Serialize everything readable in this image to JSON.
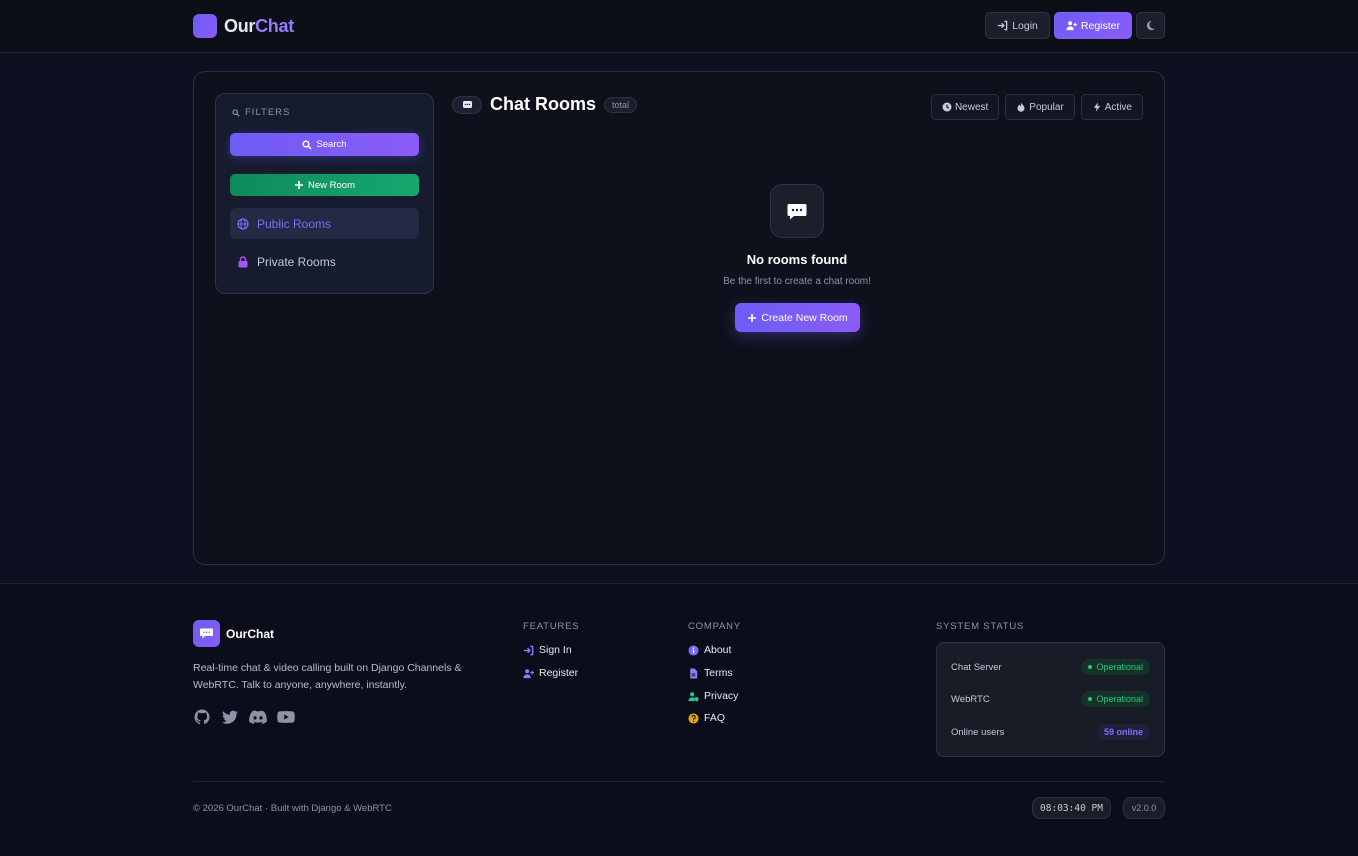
{
  "header": {
    "brand_part1": "Our",
    "brand_part2": "Chat",
    "login_label": "Login",
    "register_label": "Register",
    "theme_toggle_icon": "moon-icon"
  },
  "sidebar": {
    "filters_label": "FILTERS",
    "search_label": "Search",
    "new_room_label": "New Room",
    "items": [
      {
        "label": "Public Rooms",
        "icon": "globe-icon",
        "active": true
      },
      {
        "label": "Private Rooms",
        "icon": "lock-icon",
        "active": false
      }
    ]
  },
  "rooms": {
    "title": "Chat Rooms",
    "total_badge": "total",
    "sort": [
      {
        "label": "Newest",
        "icon": "clock-icon"
      },
      {
        "label": "Popular",
        "icon": "fire-icon"
      },
      {
        "label": "Active",
        "icon": "bolt-icon"
      }
    ],
    "empty_title": "No rooms found",
    "empty_subtitle": "Be the first to create a chat room!",
    "create_label": "Create New Room"
  },
  "footer": {
    "brand": "OurChat",
    "description": "Real-time chat & video calling built on Django Channels & WebRTC. Talk to anyone, anywhere, instantly.",
    "socials": [
      "github-icon",
      "twitter-icon",
      "discord-icon",
      "youtube-icon"
    ],
    "features_head": "FEATURES",
    "features": [
      {
        "label": "Sign In",
        "icon": "sign-in-icon"
      },
      {
        "label": "Register",
        "icon": "user-plus-icon"
      }
    ],
    "company_head": "COMPANY",
    "company": [
      {
        "label": "About",
        "icon": "info-icon"
      },
      {
        "label": "Terms",
        "icon": "file-icon"
      },
      {
        "label": "Privacy",
        "icon": "user-shield-icon"
      },
      {
        "label": "FAQ",
        "icon": "question-icon"
      }
    ],
    "status_head": "SYSTEM STATUS",
    "status": [
      {
        "name": "Chat Server",
        "value": "Operational"
      },
      {
        "name": "WebRTC",
        "value": "Operational"
      },
      {
        "name": "Online users",
        "value": "59 online"
      }
    ],
    "copyright": "© 2026 OurChat  ·  Built with Django & WebRTC",
    "clock": "08:03:40 PM",
    "version": "v2.0.0"
  },
  "colors": {
    "accent": "#8b5cf6",
    "accent_start": "#6d5cf5",
    "success": "#16a870",
    "operational": "#22c58a",
    "background": "#0d1120"
  }
}
